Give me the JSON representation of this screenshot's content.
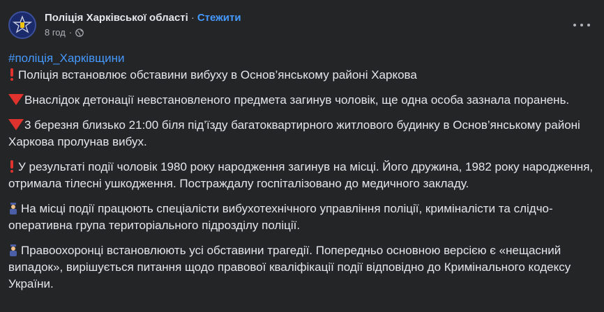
{
  "header": {
    "page_name": "Поліція Харківської області",
    "separator": "·",
    "follow_label": "Стежити",
    "time": "8 год",
    "dot": "·",
    "privacy_icon": "globe-icon"
  },
  "post": {
    "hashtag": "#поліція_Харківщини",
    "paragraphs": [
      {
        "icon": "exclamation-icon",
        "text": "Поліція встановлює обставини вибуху в Основ’янському районі Харкова"
      },
      {
        "icon": "red-triangle-icon",
        "text": "Внаслідок детонації невстановленого предмета загинув чоловік, ще одна особа зазнала поранень."
      },
      {
        "icon": "red-triangle-icon",
        "text": "3 березня близько 21:00 біля під’їзду багатоквартирного житлового будинку в Основ’янському районі Харкова пролунав вибух."
      },
      {
        "icon": "exclamation-icon",
        "text": "У результаті події чоловік 1980 року народження загинув на місці. Його дружина, 1982 року народження, отримала тілесні ушкодження. Постраждалу госпіталізовано до медичного закладу."
      },
      {
        "icon": "police-officer-icon",
        "text": "На місці події працюють спеціалісти вибухотехнічного управління поліції, криміналісти та слідчо-оперативна група територіального підрозділу поліції."
      },
      {
        "icon": "police-officer-icon",
        "text": "Правоохоронці встановлюють усі обставини трагедії. Попередньо основною версією є «нещасний випадок», вирішується питання щодо правової кваліфікації події відповідно до Кримінального кодексу України."
      }
    ]
  },
  "colors": {
    "background": "#242526",
    "text": "#e4e6eb",
    "secondary_text": "#b0b3b8",
    "link": "#4599ff",
    "emoji_red": "#e0332e"
  }
}
